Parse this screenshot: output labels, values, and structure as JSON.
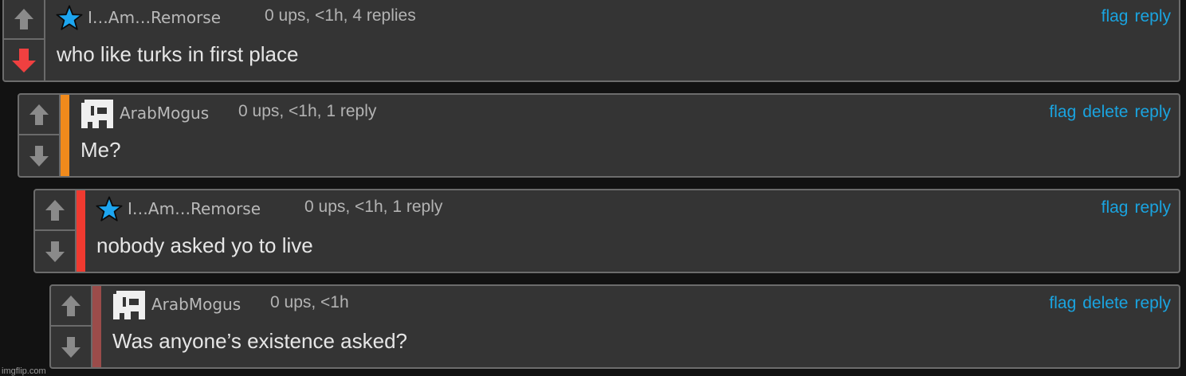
{
  "comments": [
    {
      "username": "I…Am…Remorse",
      "meta": "0 ups, <1h, 4 replies",
      "text": "who like turks in first place",
      "actions": {
        "flag": "flag",
        "reply": "reply"
      },
      "avatar_icon": "blue-star-icon",
      "downvoted": true
    },
    {
      "username": "ArabMogus",
      "meta": "0 ups, <1h, 1 reply",
      "text": "Me?",
      "actions": {
        "flag": "flag",
        "delete": "delete",
        "reply": "reply"
      },
      "avatar_icon": "pixel-avatar-icon",
      "depth_color": "#f08a1c"
    },
    {
      "username": "I…Am…Remorse",
      "meta": "0 ups, <1h, 1 reply",
      "text": "nobody asked yo to live",
      "actions": {
        "flag": "flag",
        "reply": "reply"
      },
      "avatar_icon": "blue-star-icon",
      "depth_color": "#f03a30"
    },
    {
      "username": "ArabMogus",
      "meta": "0 ups, <1h",
      "text": "Was anyone’s existence asked?",
      "actions": {
        "flag": "flag",
        "delete": "delete",
        "reply": "reply"
      },
      "avatar_icon": "pixel-avatar-icon",
      "depth_color": "#9b4c4a"
    }
  ],
  "watermark": "imgflip.com",
  "colors": {
    "link": "#1aa4e0",
    "downvote_active": "#f04040",
    "vote_inactive": "#8a8a8a"
  }
}
